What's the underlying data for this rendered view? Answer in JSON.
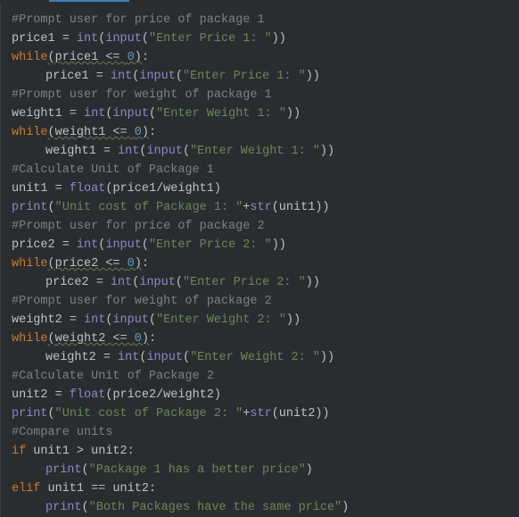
{
  "code": {
    "l1": "#Prompt user for price of package 1",
    "l2a": "price1",
    "l2b": " = ",
    "l2c": "int",
    "l2d": "(",
    "l2e": "input",
    "l2f": "(",
    "l2g": "\"Enter Price 1: \"",
    "l2h": "))",
    "l3a": "while",
    "l3b": "(",
    "l3c": "price1 <= ",
    "l3d": "0",
    "l3e": ")",
    "l3f": ":",
    "l4a": "price1",
    "l4b": " = ",
    "l4c": "int",
    "l4d": "(",
    "l4e": "input",
    "l4f": "(",
    "l4g": "\"Enter Price 1: \"",
    "l4h": "))",
    "l5": "#Prompt user for weight of package 1",
    "l6a": "weight1",
    "l6b": " = ",
    "l6c": "int",
    "l6d": "(",
    "l6e": "input",
    "l6f": "(",
    "l6g": "\"Enter Weight 1: \"",
    "l6h": "))",
    "l7a": "while",
    "l7b": "(",
    "l7c": "weight1 <= ",
    "l7d": "0",
    "l7e": ")",
    "l7f": ":",
    "l8a": "weight1",
    "l8b": " = ",
    "l8c": "int",
    "l8d": "(",
    "l8e": "input",
    "l8f": "(",
    "l8g": "\"Enter Weight 1: \"",
    "l8h": "))",
    "l9": "#Calculate Unit of Package 1",
    "l10a": "unit1",
    "l10b": " = ",
    "l10c": "float",
    "l10d": "(",
    "l10e": "price1",
    "l10f": "/",
    "l10g": "weight1",
    "l10h": ")",
    "l11a": "print",
    "l11b": "(",
    "l11c": "\"Unit cost of Package 1: \"",
    "l11d": "+",
    "l11e": "str",
    "l11f": "(",
    "l11g": "unit1",
    "l11h": "))",
    "l12": "#Prompt user for price of package 2",
    "l13a": "price2",
    "l13b": " = ",
    "l13c": "int",
    "l13d": "(",
    "l13e": "input",
    "l13f": "(",
    "l13g": "\"Enter Price 2: \"",
    "l13h": "))",
    "l14a": "while",
    "l14b": "(",
    "l14c": "price2 <= ",
    "l14d": "0",
    "l14e": ")",
    "l14f": ":",
    "l15a": "price2",
    "l15b": " = ",
    "l15c": "int",
    "l15d": "(",
    "l15e": "input",
    "l15f": "(",
    "l15g": "\"Enter Price 2: \"",
    "l15h": "))",
    "l16": "#Prompt user for weight of package 2",
    "l17a": "weight2",
    "l17b": " = ",
    "l17c": "int",
    "l17d": "(",
    "l17e": "input",
    "l17f": "(",
    "l17g": "\"Enter Weight 2: \"",
    "l17h": "))",
    "l18a": "while",
    "l18b": "(",
    "l18c": "weight2 <= ",
    "l18d": "0",
    "l18e": ")",
    "l18f": ":",
    "l19a": "weight2",
    "l19b": " = ",
    "l19c": "int",
    "l19d": "(",
    "l19e": "input",
    "l19f": "(",
    "l19g": "\"Enter Weight 2: \"",
    "l19h": "))",
    "l20": "#Calculate Unit of Package 2",
    "l21a": "unit2",
    "l21b": " = ",
    "l21c": "float",
    "l21d": "(",
    "l21e": "price2",
    "l21f": "/",
    "l21g": "weight2",
    "l21h": ")",
    "l22a": "print",
    "l22b": "(",
    "l22c": "\"Unit cost of Package 2: \"",
    "l22d": "+",
    "l22e": "str",
    "l22f": "(",
    "l22g": "unit2",
    "l22h": "))",
    "l23": "#Compare units",
    "l24a": "if",
    "l24b": " unit1 > unit2:",
    "l25a": "print",
    "l25b": "(",
    "l25c": "\"Package 1 has a better price\"",
    "l25d": ")",
    "l26a": "elif",
    "l26b": " unit1 == unit2:",
    "l27a": "print",
    "l27b": "(",
    "l27c": "\"Both Packages have the same price\"",
    "l27d": ")"
  }
}
